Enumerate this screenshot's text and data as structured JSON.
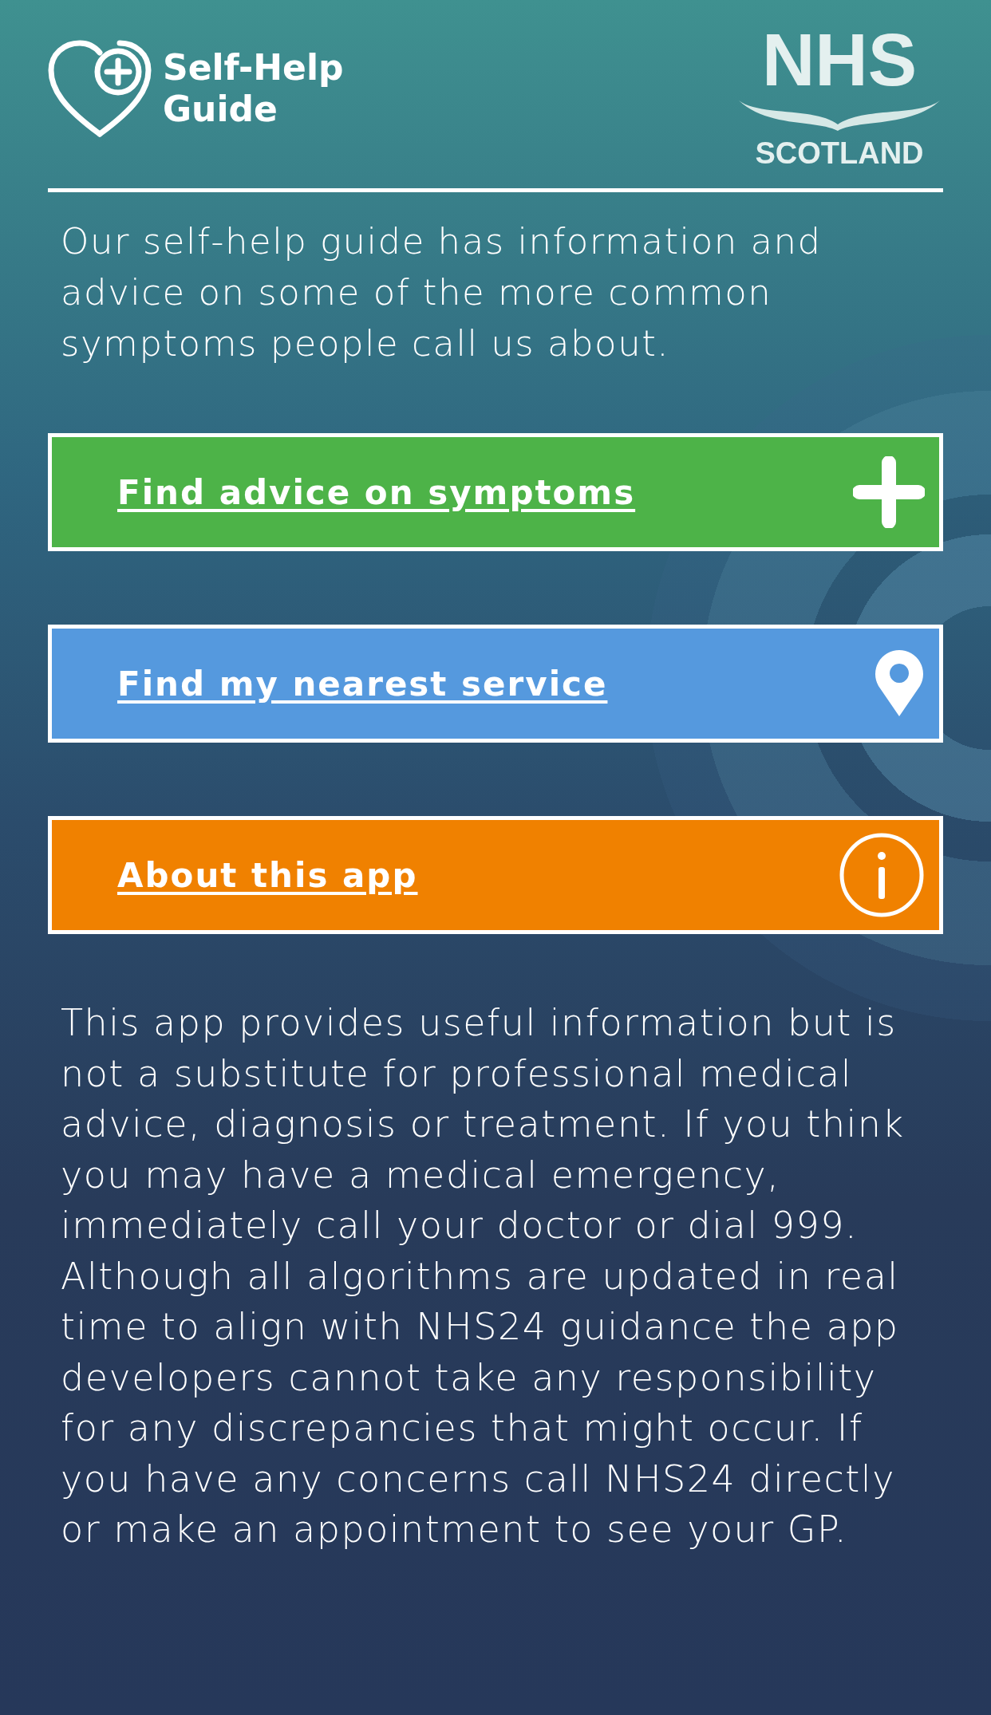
{
  "header": {
    "app_title": [
      "Self-Help",
      "Guide"
    ],
    "logo_text": {
      "main": "NHS",
      "sub": "SCOTLAND"
    }
  },
  "intro": "Our self-help guide has information and advice on some of the more common symptoms people call us about.",
  "menu": [
    {
      "label": "Find advice on symptoms",
      "kind": "plus",
      "color": "#4db348"
    },
    {
      "label": "Find my nearest service",
      "kind": "pin",
      "color": "#5599de"
    },
    {
      "label": "About this app",
      "kind": "info",
      "color": "#f08100"
    }
  ],
  "disclaimer": "This app provides useful information but is not a substitute for professional medical advice, diagnosis or treatment. If you think you may have a medical emergency, immediately call your doctor or dial 999. Although all algorithms are updated in real time to align with NHS24 guidance the app developers cannot take any responsibility for any discrepancies that might occur. If you have any concerns call NHS24 directly or make an appointment to see your GP."
}
